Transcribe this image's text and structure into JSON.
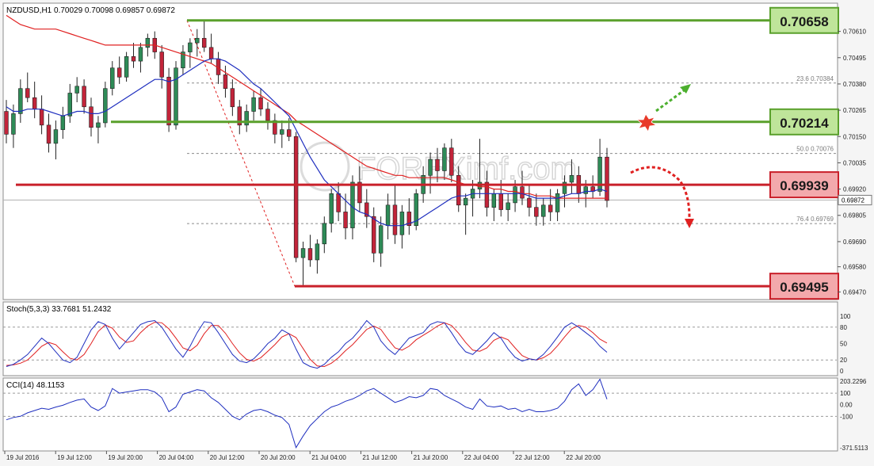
{
  "header": {
    "symbol_info": "NZDUSD,H1  0.70029 0.70098 0.69857 0.69872"
  },
  "watermark": {
    "text": "FOREXimf.com"
  },
  "price_axis": {
    "labels": [
      "0.70610",
      "0.70495",
      "0.70380",
      "0.70265",
      "0.70150",
      "0.70035",
      "0.69920",
      "0.69805",
      "0.69690",
      "0.69580",
      "0.69470"
    ],
    "current_price": "0.69872"
  },
  "levels": [
    {
      "value": 0.70658,
      "label": "0.70658",
      "kind": "resistance",
      "color": "#5aa02c"
    },
    {
      "value": 0.70214,
      "label": "0.70214",
      "kind": "resistance",
      "color": "#5aa02c"
    },
    {
      "value": 0.69939,
      "label": "0.69939",
      "kind": "support",
      "color": "#c9202a"
    },
    {
      "value": 0.69495,
      "label": "0.69495",
      "kind": "support",
      "color": "#c9202a"
    }
  ],
  "fibonacci": [
    {
      "value": 0.70384,
      "label": "23.6  0.70384"
    },
    {
      "value": 0.70076,
      "label": "50.0  0.70076"
    },
    {
      "value": 0.69769,
      "label": "76.4  0.69769"
    }
  ],
  "stoch": {
    "title": "Stoch(5,3,3) 33.7681 51.2432",
    "labels": [
      "100",
      "80",
      "50",
      "20",
      "0"
    ]
  },
  "cci": {
    "title": "CCI(14) 48.1153",
    "labels": [
      "203.2296",
      "100",
      "0.00",
      "-100",
      "-371.5113"
    ]
  },
  "time_axis": {
    "labels": [
      "19 Jul 2016",
      "19 Jul 12:00",
      "19 Jul 20:00",
      "20 Jul 04:00",
      "20 Jul 12:00",
      "20 Jul 20:00",
      "21 Jul 04:00",
      "21 Jul 12:00",
      "21 Jul 20:00",
      "22 Jul 04:00",
      "22 Jul 12:00",
      "22 Jul 20:00"
    ]
  },
  "colors": {
    "bull_candle": "#2e8b57",
    "bear_candle": "#c2243a",
    "ma_fast": "#1f2fbf",
    "ma_slow": "#e02020",
    "stoch_main": "#1f2fbf",
    "stoch_signal": "#e02020",
    "cci_line": "#1f2fbf"
  },
  "chart_data": {
    "type": "candlestick",
    "title": "NZDUSD,H1",
    "ylim": [
      0.6944,
      0.7073
    ],
    "ohlc": [
      [
        0.7026,
        0.7031,
        0.7012,
        0.7016
      ],
      [
        0.7016,
        0.7029,
        0.701,
        0.7025
      ],
      [
        0.7025,
        0.704,
        0.7021,
        0.7036
      ],
      [
        0.7036,
        0.7043,
        0.703,
        0.7032
      ],
      [
        0.7032,
        0.7039,
        0.7023,
        0.7027
      ],
      [
        0.7027,
        0.7033,
        0.7016,
        0.702
      ],
      [
        0.702,
        0.7025,
        0.7008,
        0.7012
      ],
      [
        0.7012,
        0.7022,
        0.7005,
        0.7018
      ],
      [
        0.7018,
        0.7028,
        0.7014,
        0.7024
      ],
      [
        0.7024,
        0.7038,
        0.7021,
        0.7034
      ],
      [
        0.7034,
        0.7041,
        0.703,
        0.7037
      ],
      [
        0.7037,
        0.704,
        0.7025,
        0.7028
      ],
      [
        0.7028,
        0.7032,
        0.7015,
        0.7019
      ],
      [
        0.7019,
        0.7024,
        0.7012,
        0.7021
      ],
      [
        0.7021,
        0.7039,
        0.7019,
        0.7036
      ],
      [
        0.7036,
        0.7048,
        0.7033,
        0.7045
      ],
      [
        0.7045,
        0.705,
        0.7038,
        0.7041
      ],
      [
        0.7041,
        0.7052,
        0.7039,
        0.705
      ],
      [
        0.705,
        0.7056,
        0.7045,
        0.7048
      ],
      [
        0.7048,
        0.7056,
        0.7043,
        0.7054
      ],
      [
        0.7054,
        0.706,
        0.705,
        0.7058
      ],
      [
        0.7058,
        0.7061,
        0.7049,
        0.7052
      ],
      [
        0.7052,
        0.7055,
        0.7036,
        0.7041
      ],
      [
        0.7041,
        0.7045,
        0.7017,
        0.702
      ],
      [
        0.702,
        0.7048,
        0.7018,
        0.7045
      ],
      [
        0.7045,
        0.7055,
        0.7042,
        0.7052
      ],
      [
        0.7052,
        0.7058,
        0.7045,
        0.7056
      ],
      [
        0.7056,
        0.7062,
        0.705,
        0.7058
      ],
      [
        0.7058,
        0.7066,
        0.7052,
        0.7054
      ],
      [
        0.7054,
        0.706,
        0.7047,
        0.7049
      ],
      [
        0.7049,
        0.7052,
        0.7038,
        0.7042
      ],
      [
        0.7042,
        0.7046,
        0.7032,
        0.7036
      ],
      [
        0.7036,
        0.704,
        0.7024,
        0.7028
      ],
      [
        0.7028,
        0.7031,
        0.7016,
        0.702
      ],
      [
        0.702,
        0.7029,
        0.7017,
        0.7026
      ],
      [
        0.7026,
        0.7035,
        0.7022,
        0.7032
      ],
      [
        0.7032,
        0.7036,
        0.7024,
        0.7027
      ],
      [
        0.7027,
        0.703,
        0.7018,
        0.7022
      ],
      [
        0.7022,
        0.7025,
        0.7012,
        0.7016
      ],
      [
        0.7016,
        0.7022,
        0.701,
        0.7018
      ],
      [
        0.7018,
        0.7023,
        0.7013,
        0.7015
      ],
      [
        0.7015,
        0.7017,
        0.696,
        0.6962
      ],
      [
        0.6962,
        0.6969,
        0.695,
        0.6966
      ],
      [
        0.6966,
        0.6972,
        0.6958,
        0.6961
      ],
      [
        0.6961,
        0.697,
        0.6955,
        0.6968
      ],
      [
        0.6968,
        0.698,
        0.6964,
        0.6977
      ],
      [
        0.6977,
        0.6992,
        0.6973,
        0.699
      ],
      [
        0.699,
        0.6995,
        0.6978,
        0.6982
      ],
      [
        0.6982,
        0.699,
        0.697,
        0.6975
      ],
      [
        0.6975,
        0.6998,
        0.697,
        0.6995
      ],
      [
        0.6995,
        0.7002,
        0.6982,
        0.6986
      ],
      [
        0.6986,
        0.6992,
        0.6975,
        0.698
      ],
      [
        0.698,
        0.6984,
        0.696,
        0.6964
      ],
      [
        0.6964,
        0.698,
        0.6958,
        0.6976
      ],
      [
        0.6976,
        0.699,
        0.697,
        0.6985
      ],
      [
        0.6985,
        0.6994,
        0.6968,
        0.6972
      ],
      [
        0.6972,
        0.6985,
        0.6966,
        0.6982
      ],
      [
        0.6982,
        0.6988,
        0.6972,
        0.6976
      ],
      [
        0.6976,
        0.6992,
        0.6974,
        0.699
      ],
      [
        0.699,
        0.7002,
        0.6986,
        0.6998
      ],
      [
        0.6998,
        0.7008,
        0.699,
        0.7005
      ],
      [
        0.7005,
        0.701,
        0.6995,
        0.7
      ],
      [
        0.7,
        0.7012,
        0.6996,
        0.701
      ],
      [
        0.701,
        0.7014,
        0.6995,
        0.6998
      ],
      [
        0.6998,
        0.7002,
        0.6982,
        0.6985
      ],
      [
        0.6985,
        0.699,
        0.6972,
        0.6988
      ],
      [
        0.6988,
        0.6996,
        0.698,
        0.6992
      ],
      [
        0.6992,
        0.7014,
        0.6988,
        0.6995
      ],
      [
        0.6995,
        0.7,
        0.698,
        0.6984
      ],
      [
        0.6984,
        0.6992,
        0.6978,
        0.699
      ],
      [
        0.699,
        0.6996,
        0.698,
        0.6983
      ],
      [
        0.6983,
        0.699,
        0.6978,
        0.6986
      ],
      [
        0.6986,
        0.6996,
        0.6982,
        0.6993
      ],
      [
        0.6993,
        0.7,
        0.6985,
        0.6988
      ],
      [
        0.6988,
        0.6994,
        0.698,
        0.6984
      ],
      [
        0.6984,
        0.699,
        0.6976,
        0.698
      ],
      [
        0.698,
        0.6988,
        0.6976,
        0.6985
      ],
      [
        0.6985,
        0.6992,
        0.6978,
        0.6982
      ],
      [
        0.6982,
        0.6992,
        0.6978,
        0.699
      ],
      [
        0.699,
        0.6998,
        0.6984,
        0.6995
      ],
      [
        0.6995,
        0.7005,
        0.699,
        0.6998
      ],
      [
        0.6998,
        0.7002,
        0.6986,
        0.699
      ],
      [
        0.699,
        0.6996,
        0.6984,
        0.6993
      ],
      [
        0.6993,
        0.6998,
        0.6988,
        0.6991
      ],
      [
        0.6991,
        0.7014,
        0.6989,
        0.7006
      ],
      [
        0.7006,
        0.701,
        0.6984,
        0.6987
      ]
    ],
    "ma_fast": [
      0.7028,
      0.7026,
      0.7026,
      0.7027,
      0.7027,
      0.7027,
      0.7026,
      0.7025,
      0.7024,
      0.7025,
      0.7026,
      0.7026,
      0.7025,
      0.7025,
      0.7026,
      0.7028,
      0.703,
      0.7032,
      0.7034,
      0.7036,
      0.7038,
      0.704,
      0.704,
      0.7039,
      0.704,
      0.7042,
      0.7044,
      0.7046,
      0.7048,
      0.7049,
      0.7049,
      0.7048,
      0.7046,
      0.7044,
      0.7041,
      0.7038,
      0.7036,
      0.7033,
      0.703,
      0.7027,
      0.7024,
      0.7018,
      0.7012,
      0.7006,
      0.7001,
      0.6996,
      0.6993,
      0.699,
      0.6987,
      0.6984,
      0.6982,
      0.6981,
      0.6979,
      0.6977,
      0.6976,
      0.6976,
      0.6976,
      0.6977,
      0.6978,
      0.698,
      0.6982,
      0.6984,
      0.6986,
      0.6988,
      0.6989,
      0.6989,
      0.699,
      0.699,
      0.699,
      0.699,
      0.699,
      0.699,
      0.699,
      0.699,
      0.6989,
      0.6988,
      0.6988,
      0.6988,
      0.6988,
      0.6989,
      0.699,
      0.699,
      0.6991,
      0.6991,
      0.6992,
      0.6991
    ],
    "ma_slow": [
      0.7068,
      0.7066,
      0.7064,
      0.7063,
      0.7062,
      0.7062,
      0.7062,
      0.7062,
      0.7061,
      0.706,
      0.7059,
      0.7058,
      0.7057,
      0.7056,
      0.7055,
      0.7055,
      0.7055,
      0.7055,
      0.7055,
      0.7055,
      0.7055,
      0.7055,
      0.7054,
      0.7053,
      0.7052,
      0.7051,
      0.705,
      0.7049,
      0.7048,
      0.7047,
      0.7045,
      0.7043,
      0.7041,
      0.7039,
      0.7037,
      0.7035,
      0.7033,
      0.7031,
      0.7029,
      0.7027,
      0.7025,
      0.7022,
      0.702,
      0.7018,
      0.7016,
      0.7014,
      0.7012,
      0.701,
      0.7008,
      0.7006,
      0.7004,
      0.7002,
      0.7001,
      0.7,
      0.6999,
      0.6998,
      0.6998,
      0.6997,
      0.6997,
      0.6997,
      0.6997,
      0.6997,
      0.6997,
      0.6996,
      0.6995,
      0.6994,
      0.6994,
      0.6993,
      0.6993,
      0.6992,
      0.6992,
      0.6991,
      0.6991,
      0.699,
      0.699,
      0.6989,
      0.6989,
      0.6989,
      0.6988,
      0.6988,
      0.6988,
      0.6988,
      0.6988,
      0.6988,
      0.6988,
      0.6988
    ],
    "stoch_main": [
      8,
      12,
      20,
      30,
      45,
      60,
      50,
      35,
      20,
      15,
      25,
      50,
      75,
      90,
      85,
      60,
      40,
      55,
      70,
      85,
      90,
      92,
      80,
      60,
      40,
      25,
      45,
      70,
      90,
      88,
      70,
      50,
      30,
      18,
      15,
      22,
      35,
      50,
      60,
      75,
      68,
      40,
      15,
      8,
      5,
      12,
      25,
      35,
      50,
      60,
      75,
      92,
      80,
      55,
      40,
      30,
      45,
      60,
      65,
      70,
      85,
      90,
      88,
      70,
      50,
      35,
      30,
      42,
      55,
      70,
      60,
      40,
      25,
      18,
      22,
      20,
      30,
      45,
      62,
      80,
      88,
      80,
      70,
      60,
      45,
      34
    ],
    "stoch_signal": [
      10,
      11,
      14,
      20,
      32,
      45,
      52,
      48,
      35,
      23,
      20,
      30,
      50,
      72,
      84,
      78,
      62,
      52,
      55,
      70,
      82,
      89,
      88,
      77,
      60,
      42,
      37,
      47,
      68,
      83,
      83,
      69,
      50,
      33,
      21,
      18,
      24,
      36,
      48,
      62,
      68,
      61,
      41,
      21,
      9,
      8,
      14,
      24,
      37,
      48,
      62,
      76,
      82,
      76,
      58,
      42,
      38,
      45,
      57,
      65,
      73,
      82,
      88,
      83,
      69,
      52,
      38,
      36,
      42,
      56,
      62,
      57,
      42,
      28,
      22,
      20,
      24,
      32,
      46,
      62,
      77,
      83,
      80,
      70,
      58,
      51
    ],
    "cci": [
      -130,
      -110,
      -100,
      -70,
      -50,
      -30,
      -40,
      -20,
      -5,
      20,
      40,
      50,
      -20,
      -50,
      -10,
      140,
      100,
      110,
      120,
      130,
      130,
      110,
      60,
      -60,
      -20,
      90,
      110,
      130,
      120,
      60,
      20,
      -40,
      -100,
      -130,
      -80,
      -50,
      -40,
      -60,
      -90,
      -110,
      -170,
      -370,
      -270,
      -180,
      -120,
      -60,
      -20,
      0,
      30,
      50,
      80,
      120,
      140,
      100,
      60,
      20,
      40,
      70,
      60,
      80,
      140,
      130,
      80,
      50,
      20,
      -20,
      -40,
      50,
      -10,
      -20,
      -10,
      -40,
      -30,
      -60,
      -40,
      -60,
      -60,
      -50,
      -30,
      30,
      130,
      180,
      80,
      130,
      220,
      48
    ],
    "level_lines": [
      0.70658,
      0.70214,
      0.69939,
      0.69495
    ],
    "fib_levels": [
      0.70384,
      0.70076,
      0.69769
    ]
  }
}
